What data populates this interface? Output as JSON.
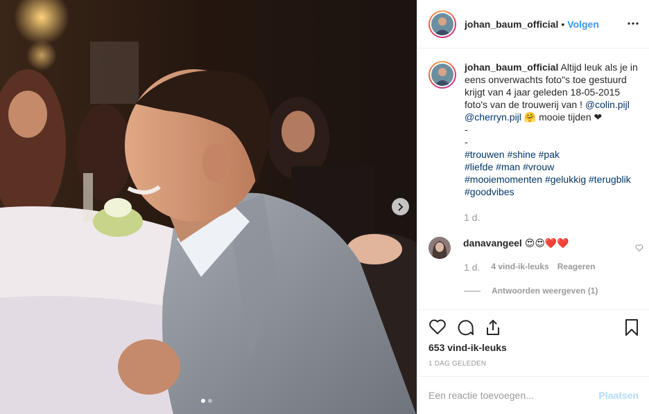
{
  "header": {
    "username": "johan_baum_official",
    "separator": "•",
    "follow_label": "Volgen"
  },
  "caption": {
    "username": "johan_baum_official",
    "text_part1": "Altijd leuk als je in eens onverwachts foto\"s toe gestuurd krijgt van 4 jaar geleden 18-05-2015 foto's van de trouwerij van !",
    "mention1": "@colin.pijl",
    "mention2": "@cherryn.pijl",
    "emoji": "🤗",
    "text_part2": "mooie tijden",
    "heart": "❤",
    "dash1": "-",
    "dash2": "-",
    "hashtags": [
      "#trouwen",
      "#shine",
      "#pak",
      "#liefde",
      "#man",
      "#vrouw",
      "#mooiemomenten",
      "#gelukkig",
      "#terugblik",
      "#goodvibes"
    ],
    "time": "1 d."
  },
  "comment": {
    "username": "danavangeel",
    "text": "😍😍❤️❤️",
    "time": "1 d.",
    "likes": "4 vind-ik-leuks",
    "reply_label": "Reageren",
    "view_replies": "Antwoorden weergeven (1)"
  },
  "stats": {
    "likes": "653 vind-ik-leuks",
    "date": "1 DAG GELEDEN"
  },
  "add_comment": {
    "placeholder": "Een reactie toevoegen...",
    "post_label": "Plaatsen"
  },
  "carousel": {
    "slide_count": 2,
    "active_index": 0
  },
  "icons": {
    "more": "more-options-icon",
    "like": "heart-outline-icon",
    "comment": "comment-bubble-icon",
    "share": "share-icon",
    "save": "bookmark-icon",
    "next": "chevron-right-icon"
  }
}
